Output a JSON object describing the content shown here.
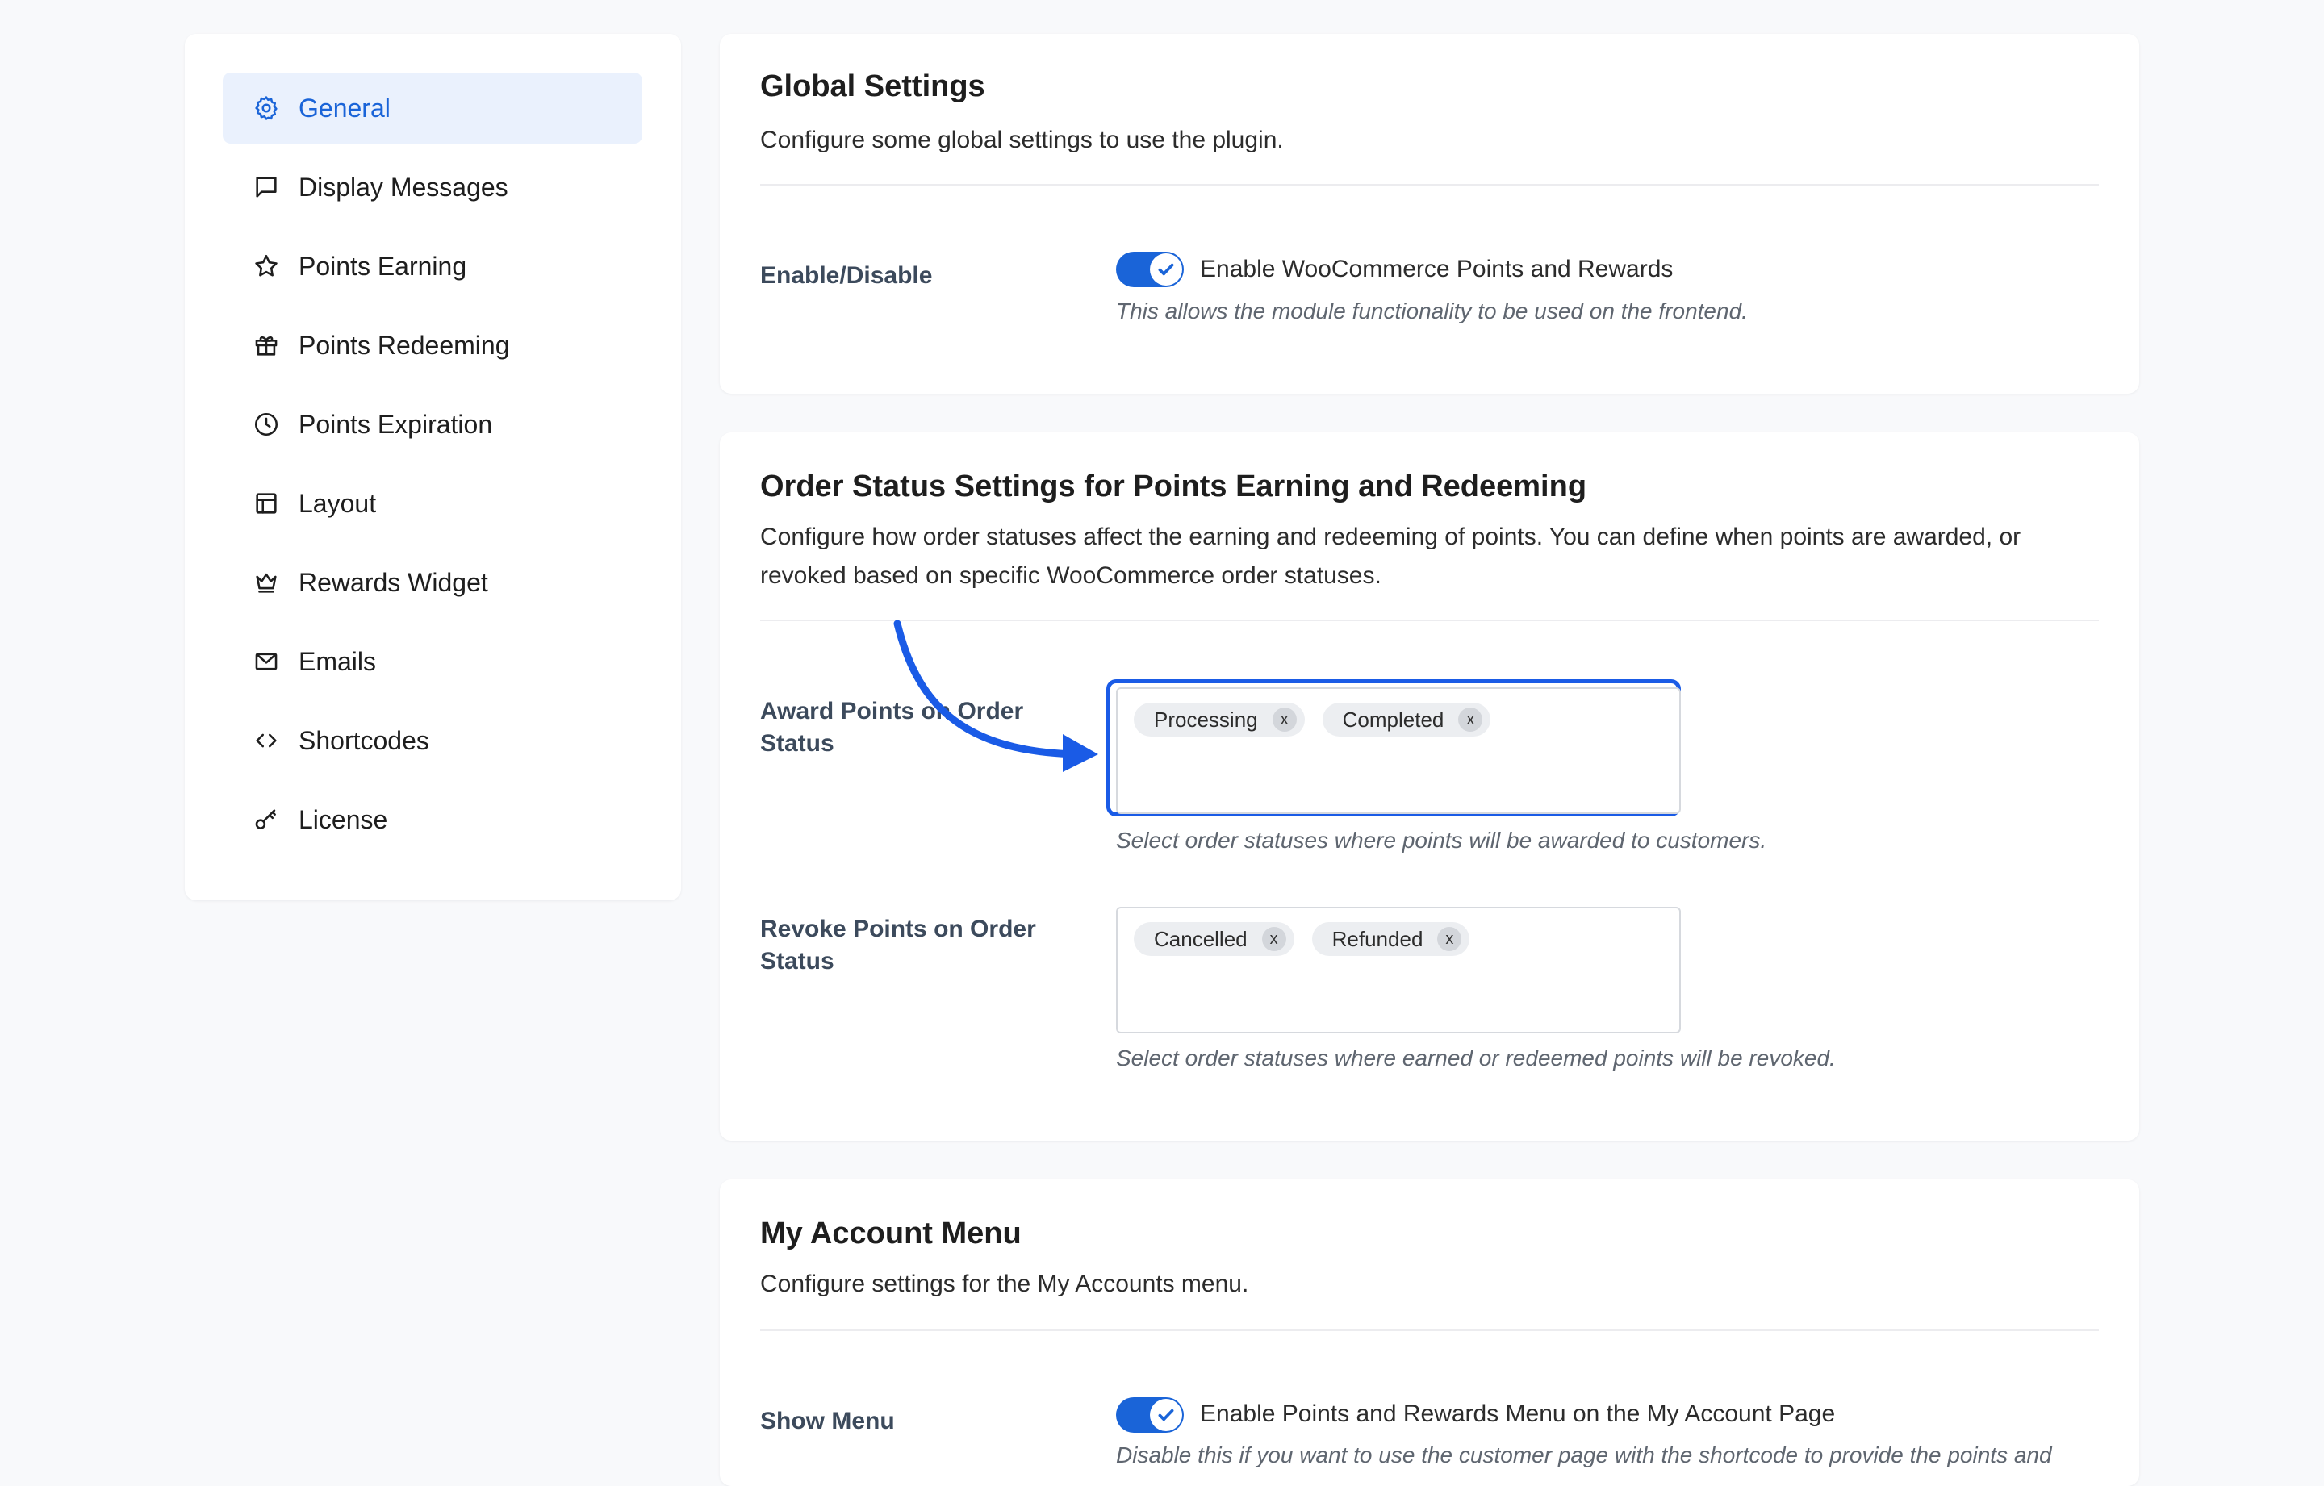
{
  "sidebar": {
    "items": [
      {
        "label": "General",
        "icon": "gear-icon",
        "active": true
      },
      {
        "label": "Display Messages",
        "icon": "message-icon",
        "active": false
      },
      {
        "label": "Points Earning",
        "icon": "star-icon",
        "active": false
      },
      {
        "label": "Points Redeeming",
        "icon": "gift-icon",
        "active": false
      },
      {
        "label": "Points Expiration",
        "icon": "clock-icon",
        "active": false
      },
      {
        "label": "Layout",
        "icon": "layout-icon",
        "active": false
      },
      {
        "label": "Rewards Widget",
        "icon": "crown-icon",
        "active": false
      },
      {
        "label": "Emails",
        "icon": "mail-icon",
        "active": false
      },
      {
        "label": "Shortcodes",
        "icon": "code-icon",
        "active": false
      },
      {
        "label": "License",
        "icon": "key-icon",
        "active": false
      }
    ]
  },
  "global": {
    "title": "Global Settings",
    "description": "Configure some global settings to use the plugin.",
    "enable_label": "Enable/Disable",
    "toggle_text": "Enable WooCommerce Points and Rewards",
    "toggle_on": true,
    "help": "This allows the module functionality to be used on the frontend."
  },
  "order_status": {
    "title": "Order Status Settings for Points Earning and Redeeming",
    "description_line1": "Configure how order statuses affect the earning and redeeming of points. You can define when points are awarded, or",
    "description_line2": "revoked based on specific WooCommerce order statuses.",
    "award_label_line1": "Award Points on Order",
    "award_label_line2": "Status",
    "award_chips": [
      "Processing",
      "Completed"
    ],
    "award_help": "Select order statuses where points will be awarded to customers.",
    "revoke_label_line1": "Revoke Points on Order",
    "revoke_label_line2": "Status",
    "revoke_chips": [
      "Cancelled",
      "Refunded"
    ],
    "revoke_help": "Select order statuses where earned or redeemed points will be revoked.",
    "chip_remove": "x"
  },
  "account": {
    "title": "My Account Menu",
    "description": "Configure settings for the My Accounts menu.",
    "show_label": "Show Menu",
    "toggle_text": "Enable Points and Rewards Menu on the My Account Page",
    "toggle_on": true,
    "help": "Disable this if you want to use the customer page with the shortcode to provide the points and"
  },
  "colors": {
    "accent": "#1a64d8",
    "highlight": "#1a5be6",
    "active_bg": "#eaf1fd"
  }
}
